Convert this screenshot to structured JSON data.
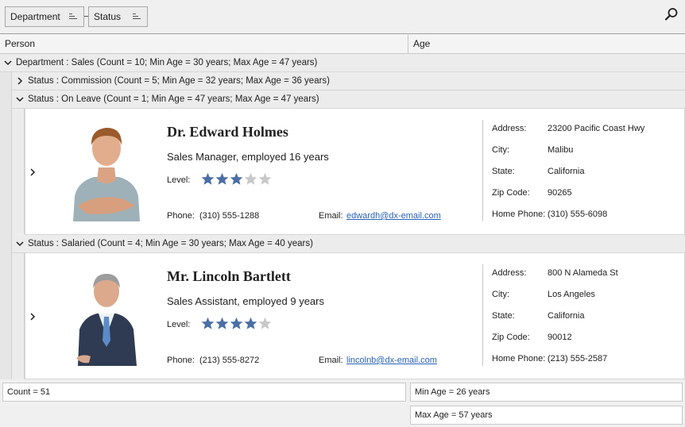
{
  "group_panel": {
    "chips": [
      {
        "label": "Department"
      },
      {
        "label": "Status"
      }
    ]
  },
  "columns": [
    "Person",
    "Age"
  ],
  "groups": {
    "department_sales": "Department : Sales (Count = 10; Min Age = 30 years; Max Age = 47 years)",
    "status_commission": "Status : Commission (Count = 5; Min Age = 32 years; Max Age = 36 years)",
    "status_on_leave": "Status : On Leave (Count = 1; Min Age = 47 years; Max Age = 47 years)",
    "status_salaried": "Status : Salaried (Count = 4; Min Age = 30 years; Max Age = 40 years)"
  },
  "records": [
    {
      "name": "Dr. Edward Holmes",
      "title": "Sales Manager, employed 16 years",
      "level_label": "Level:",
      "level": 3,
      "level_max": 5,
      "phone_label": "Phone:",
      "phone": "(310) 555-1288",
      "email_label": "Email:",
      "email": "edwardh@dx-email.com",
      "address_label": "Address:",
      "address": "23200 Pacific Coast Hwy",
      "city_label": "City:",
      "city": "Malibu",
      "state_label": "State:",
      "state": "California",
      "zip_label": "Zip Code:",
      "zip": "90265",
      "home_phone_label": "Home Phone:",
      "home_phone": "(310) 555-6098"
    },
    {
      "name": "Mr. Lincoln Bartlett",
      "title": "Sales Assistant, employed 9 years",
      "level_label": "Level:",
      "level": 4,
      "level_max": 5,
      "phone_label": "Phone:",
      "phone": "(213) 555-8272",
      "email_label": "Email:",
      "email": "lincolnb@dx-email.com",
      "address_label": "Address:",
      "address": "800 N Alameda St",
      "city_label": "City:",
      "city": "Los Angeles",
      "state_label": "State:",
      "state": "California",
      "zip_label": "Zip Code:",
      "zip": "90012",
      "home_phone_label": "Home Phone:",
      "home_phone": "(213) 555-2587"
    }
  ],
  "footer": {
    "count": "Count = 51",
    "min_age": "Min Age =  26 years",
    "max_age": "Max Age = 57 years"
  },
  "colors": {
    "star_filled": "#4a6fa5",
    "star_empty": "#c8c8c8",
    "link": "#2a62b8"
  },
  "icons": {
    "find": "magnifier-icon",
    "expand": "chevron-down-icon",
    "collapse": "chevron-right-icon",
    "sort": "sort-ascending-icon"
  }
}
